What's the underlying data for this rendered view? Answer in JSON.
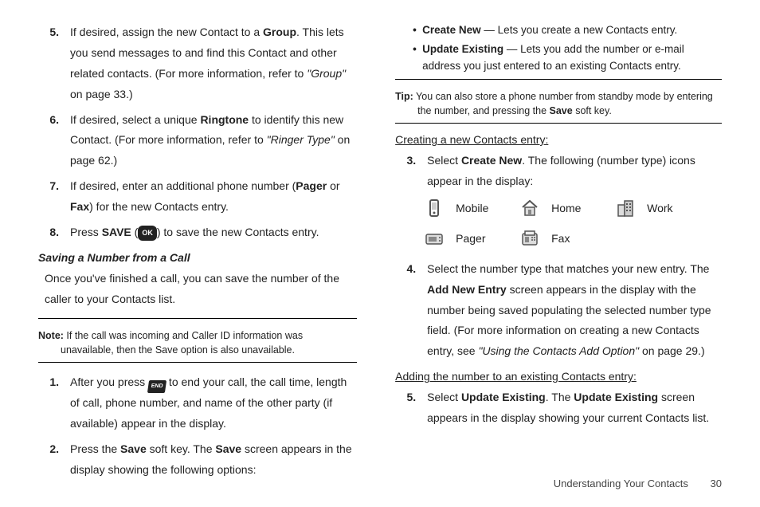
{
  "left": {
    "items": [
      {
        "num": "5.",
        "pre": "If desired, assign the new Contact to a ",
        "b1": "Group",
        "post": ". This lets you send messages to and find this Contact and other related contacts. (For more information, refer to ",
        "ref": "\"Group\"",
        "post2": "  on page 33.)"
      },
      {
        "num": "6.",
        "pre": "If desired, select a unique ",
        "b1": "Ringtone",
        "post": " to identify this new Contact. (For more information, refer to ",
        "ref": "\"Ringer Type\"",
        "post2": "  on page 62.)"
      },
      {
        "num": "7.",
        "pre": "If desired, enter an additional phone number (",
        "b1": "Pager",
        "mid": " or ",
        "b2": "Fax",
        "post": ") for the new Contacts entry."
      },
      {
        "num": "8.",
        "pre": "Press ",
        "b1": "SAVE",
        "paren_open": " (",
        "ok": "OK",
        "paren_close": ") to save the new Contacts entry."
      }
    ],
    "subheading": "Saving a Number from a Call",
    "intro": "Once you've finished a call, you can save the number of the caller to your Contacts list.",
    "note_lbl": "Note:",
    "note": " If the call was incoming and Caller ID information was unavailable, then the Save option is also unavailable.",
    "steps2": [
      {
        "num": "1.",
        "pre": "After you press ",
        "end": "END",
        "post": " to end your call, the call time, length of call, phone number, and name of the other party (if available) appear in the display."
      },
      {
        "num": "2.",
        "pre": "Press the ",
        "b1": "Save",
        "mid": " soft key. The ",
        "b2": "Save",
        "post": " screen appears in the display showing the following options:"
      }
    ]
  },
  "right": {
    "bullets": [
      {
        "b": "Create New",
        "post": " — Lets you create a new Contacts entry."
      },
      {
        "b": "Update Existing",
        "post": " — Lets you add the number or e-mail address you just entered to an existing Contacts entry."
      }
    ],
    "tip_lbl": "Tip:",
    "tip_pre": " You can also store a phone number from standby mode by entering the number, and pressing the ",
    "tip_b": "Save",
    "tip_post": " soft key.",
    "sec1_heading": "Creating a new Contacts entry:",
    "sec1_steps": [
      {
        "num": "3.",
        "pre": "Select ",
        "b1": "Create New",
        "post": ". The following (number type) icons appear in the display:"
      }
    ],
    "icons": {
      "mobile": "Mobile",
      "home": "Home",
      "work": "Work",
      "pager": "Pager",
      "fax": "Fax"
    },
    "sec1_steps2": [
      {
        "num": "4.",
        "pre": "Select the number type that matches your new entry. The ",
        "b1": "Add New Entry",
        "post": " screen appears in the display with the number being saved populating the selected number type field. (For more information on creating a new Contacts entry, see ",
        "ref": "\"Using the Contacts Add Option\"",
        "post2": " on page 29.)"
      }
    ],
    "sec2_heading": "Adding the number to an existing Contacts entry:",
    "sec2_steps": [
      {
        "num": "5.",
        "pre": "Select ",
        "b1": "Update Existing",
        "mid": ". The ",
        "b2": "Update Existing",
        "post": " screen appears in the display showing your current Contacts list."
      }
    ]
  },
  "footer": {
    "section": "Understanding Your Contacts",
    "page": "30"
  }
}
